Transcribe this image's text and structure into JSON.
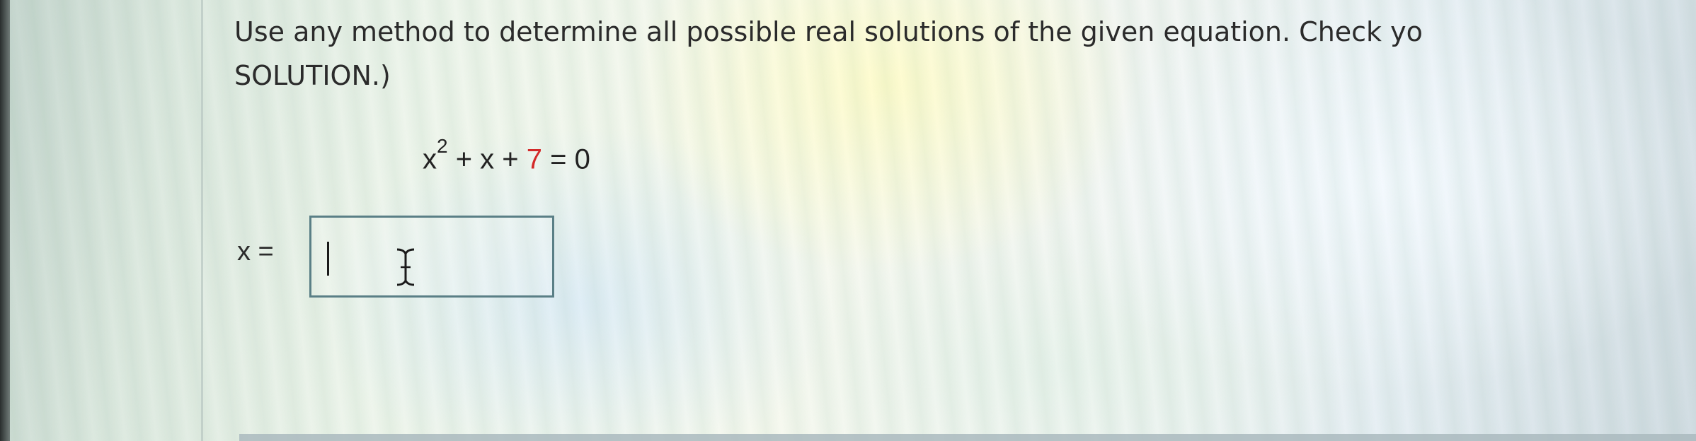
{
  "question": {
    "instruction_line1": "Use any method to determine all possible real solutions of the given equation. Check yo",
    "instruction_line2": "SOLUTION.)"
  },
  "equation": {
    "base_var": "x",
    "exponent": "2",
    "middle": " + x + ",
    "constant": "7",
    "tail": " = 0",
    "constant_color": "#d32a2a"
  },
  "answer": {
    "label": "x =",
    "value": ""
  },
  "icons": {
    "text_cursor": "i-beam-cursor-icon"
  }
}
